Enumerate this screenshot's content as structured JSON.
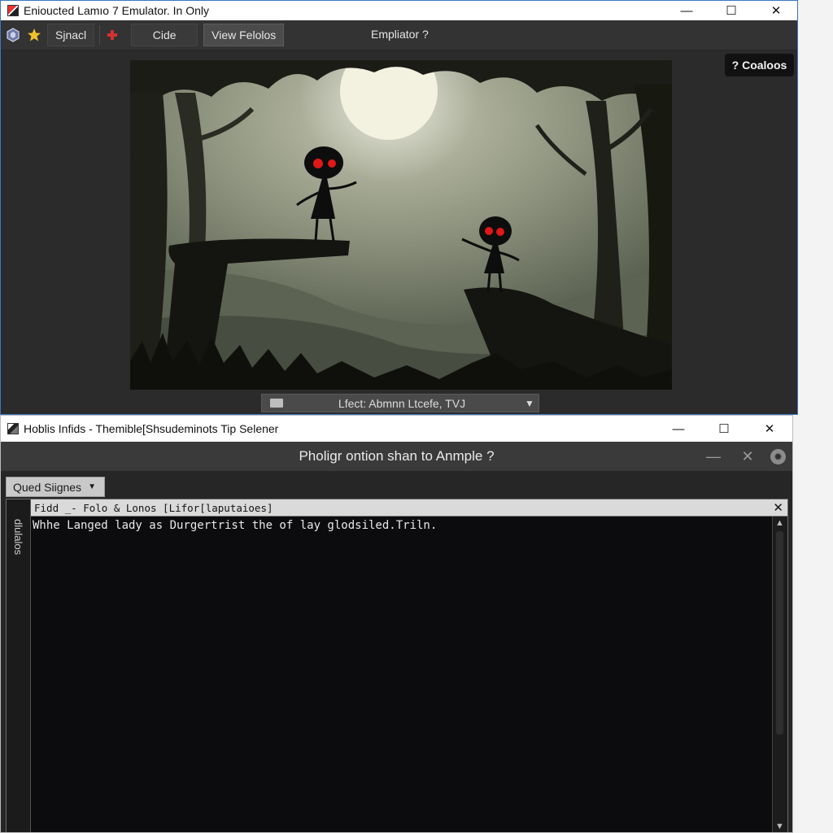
{
  "window_top": {
    "title": "Enioucted Lamıo 7 Emulator. In Only",
    "toolbar": {
      "hex_icon": "hexagon-icon",
      "star_icon": "star-icon",
      "button_special": "Sjnacl",
      "flag_icon": "flag-icon",
      "button_code": "Cide",
      "button_view": "View Felolos",
      "emulator_label": "Empliator ?"
    },
    "help_badge": "? Coaloos",
    "state_bar": {
      "label": "Lfect: Abmnn Ltcefe, TVJ"
    }
  },
  "window_bottom": {
    "title": "Hoblis Infids - Themible[Shsudeminots Tip Selener",
    "prompt": "Pholigr ontion shan to Anmple ?",
    "dropdown": "Qued Siignes",
    "side_tab": "dlulalos",
    "console": {
      "header": "Fidd _- Folo & Lonos [Lifor[laputaioes]",
      "line1": "Whhe Langed lady as Durgertrist the of lay glodsiled.Triln."
    }
  },
  "colors": {
    "accent_blue": "#3b76c2",
    "dark_bg": "#2b2b2b",
    "console_bg": "#0c0c0e"
  }
}
